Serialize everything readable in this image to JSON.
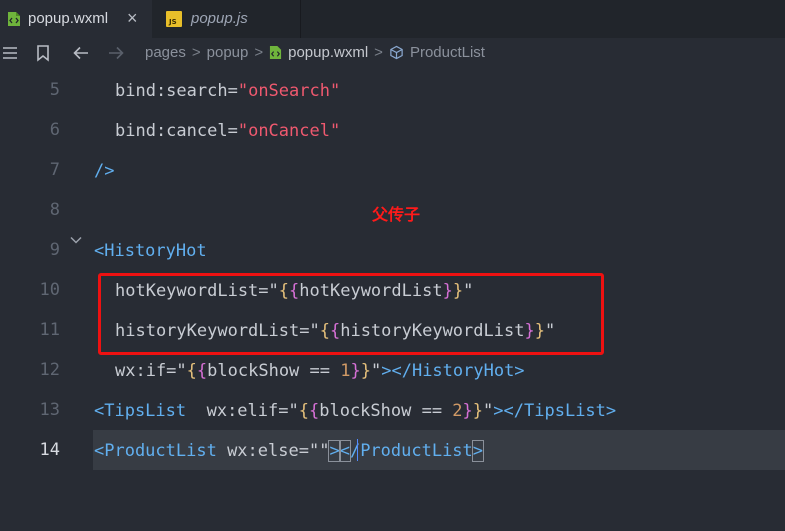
{
  "tabs": [
    {
      "label": "popup.wxml",
      "active": true,
      "icon": "wxml-file-icon"
    },
    {
      "label": "popup.js",
      "active": false,
      "icon": "js-file-icon",
      "icon_text": "JS"
    }
  ],
  "tab_close_glyph": "×",
  "breadcrumb": {
    "items": [
      "pages",
      "popup"
    ],
    "file": "popup.wxml",
    "symbol": "ProductList",
    "separator": ">"
  },
  "editor": {
    "current_line": "14",
    "lines": [
      {
        "num": "5",
        "attr": "bind:search=",
        "q1": "\"",
        "val": "onSearch",
        "q2": "\""
      },
      {
        "num": "6",
        "attr": "bind:cancel=",
        "q1": "\"",
        "val": "onCancel",
        "q2": "\""
      },
      {
        "num": "7",
        "tag": "/>"
      },
      {
        "num": "8"
      },
      {
        "num": "9",
        "tag": "<HistoryHot"
      },
      {
        "num": "10",
        "attr": "hotKeywordList=",
        "q1": "\"",
        "ob1": "{",
        "ob2": "{",
        "expr": "hotKeywordList",
        "cb2": "}",
        "cb1": "}",
        "q2": "\""
      },
      {
        "num": "11",
        "attr": "historyKeywordList=",
        "q1": "\"",
        "ob1": "{",
        "ob2": "{",
        "expr": "historyKeywordList",
        "cb2": "}",
        "cb1": "}",
        "q2": "\""
      },
      {
        "num": "12",
        "attr": "wx:if=",
        "q1": "\"",
        "ob1": "{",
        "ob2": "{",
        "expr": "blockShow == ",
        "n": "1",
        "cb2": "}",
        "cb1": "}",
        "q2": "\"",
        "tail_gt": ">",
        "close_tag": "</HistoryHot>"
      },
      {
        "num": "13",
        "tag": "<TipsList",
        "attr": "  wx:elif=",
        "q1": "\"",
        "ob1": "{",
        "ob2": "{",
        "expr": "blockShow == ",
        "n": "2",
        "cb2": "}",
        "cb1": "}",
        "q2": "\"",
        "tail_gt": ">",
        "close_tag": "</TipsList>"
      },
      {
        "num": "14",
        "tag": "<ProductList",
        "attr": " wx:else=",
        "q1": "\"",
        "q2": "\"",
        "tail_gt": ">",
        "close_open": "<",
        "close_name": "/ProductList",
        "close_gt": ">"
      }
    ]
  },
  "annotation": {
    "text": "父传子",
    "color": "#ff1a1a"
  },
  "colors": {
    "background": "#282c34",
    "tag": "#61afef",
    "string": "#ef596f",
    "number": "#d19a66",
    "brace_outer": "#e5c07b",
    "brace_inner": "#d670d6"
  },
  "icons": [
    "menu-icon",
    "bookmark-icon",
    "back-arrow-icon",
    "forward-arrow-icon",
    "chevron-down-icon",
    "component-symbol-icon"
  ]
}
